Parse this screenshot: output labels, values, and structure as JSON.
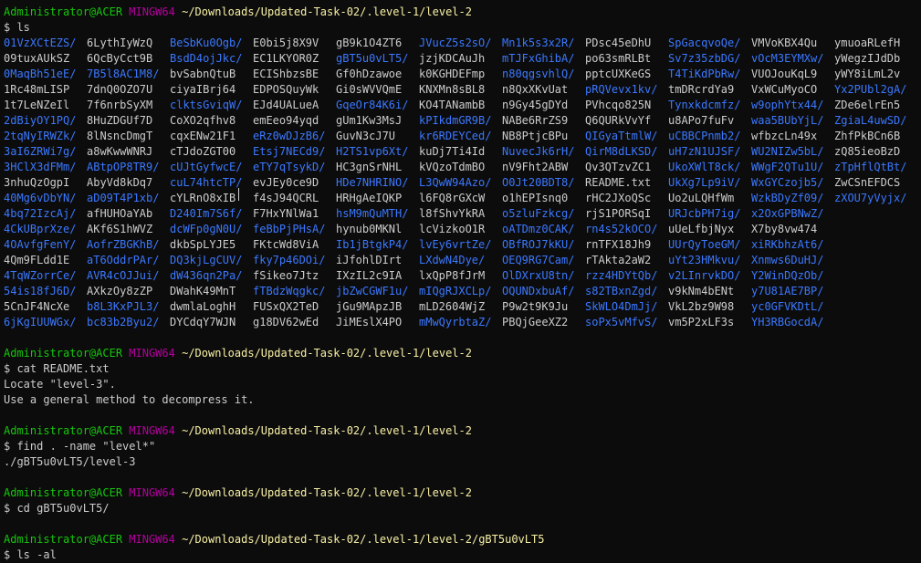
{
  "colors": {
    "background": "#0c0c0c",
    "user": "#16c60c",
    "host": "#b4009e",
    "path": "#f9f1a5",
    "directory": "#3b78ff",
    "text": "#cccccc"
  },
  "ls_listing": {
    "rows": [
      [
        {
          "t": "01VzXCtEZS/",
          "d": true
        },
        {
          "t": "6LythIyWzQ",
          "d": false
        },
        {
          "t": "BeSbKu0Ogb/",
          "d": true
        },
        {
          "t": "E0bi5j8X9V",
          "d": false
        },
        {
          "t": "gB9k1O4ZT6",
          "d": false
        },
        {
          "t": "JVucZ5s2sO/",
          "d": true
        },
        {
          "t": "Mn1k5s3x2R/",
          "d": true
        },
        {
          "t": "PDsc45eDhU",
          "d": false
        },
        {
          "t": "SpGacqvoQe/",
          "d": true
        },
        {
          "t": "VMVoKBX4Qu",
          "d": false
        },
        {
          "t": "ymuoaRLefH",
          "d": false
        }
      ],
      [
        {
          "t": "09tuxAUkSZ",
          "d": false
        },
        {
          "t": "6QcByCct9B",
          "d": false
        },
        {
          "t": "BsdD4ojJkc/",
          "d": true
        },
        {
          "t": "EC1LKYOR0Z",
          "d": false
        },
        {
          "t": "gBT5u0vLT5/",
          "d": true
        },
        {
          "t": "jzjKDCAuJh",
          "d": false
        },
        {
          "t": "mTJFxGhibA/",
          "d": true
        },
        {
          "t": "po63smRLBt",
          "d": false
        },
        {
          "t": "Sv7z35zbDG/",
          "d": true
        },
        {
          "t": "vOcM3EYMXw/",
          "d": true
        },
        {
          "t": "yWegzIJdDb",
          "d": false
        }
      ],
      [
        {
          "t": "0MaqBh51eE/",
          "d": true
        },
        {
          "t": "7B5l8AC1M8/",
          "d": true
        },
        {
          "t": "bvSabnQtuB",
          "d": false
        },
        {
          "t": "ECIShbzsBE",
          "d": false
        },
        {
          "t": "Gf0hDzawoe",
          "d": false
        },
        {
          "t": "k0KGHDEFmp",
          "d": false
        },
        {
          "t": "n80qgsvhlQ/",
          "d": true
        },
        {
          "t": "pptcUXKeGS",
          "d": false
        },
        {
          "t": "T4TiKdPbRw/",
          "d": true
        },
        {
          "t": "VUOJouKqL9",
          "d": false
        },
        {
          "t": "yWY8iLmL2v",
          "d": false
        }
      ],
      [
        {
          "t": "1Rc48mLISP",
          "d": false
        },
        {
          "t": "7dnQ0OZO7U",
          "d": false
        },
        {
          "t": "ciyaIBrj64",
          "d": false
        },
        {
          "t": "EDPOSQuyWk",
          "d": false
        },
        {
          "t": "Gi0sWVVQmE",
          "d": false
        },
        {
          "t": "KNXMn8sBL8",
          "d": false
        },
        {
          "t": "n8QxXKvUat",
          "d": false
        },
        {
          "t": "pRQVevx1kv/",
          "d": true
        },
        {
          "t": "tmDRcrdYa9",
          "d": false
        },
        {
          "t": "VxWCuMyoCO",
          "d": false
        },
        {
          "t": "Yx2PUbl2gA/",
          "d": true
        }
      ],
      [
        {
          "t": "1t7LeNZeIl",
          "d": false
        },
        {
          "t": "7f6nrbSyXM",
          "d": false
        },
        {
          "t": "clktsGviqW/",
          "d": true
        },
        {
          "t": "EJd4UALueA",
          "d": false
        },
        {
          "t": "GqeOr84K6i/",
          "d": true
        },
        {
          "t": "KO4TANambB",
          "d": false
        },
        {
          "t": "n9Gy45gDYd",
          "d": false
        },
        {
          "t": "PVhcqo825N",
          "d": false
        },
        {
          "t": "Tynxkdcmfz/",
          "d": true
        },
        {
          "t": "w9ophYtx44/",
          "d": true
        },
        {
          "t": "ZDe6elrEn5",
          "d": false
        }
      ],
      [
        {
          "t": "2dBiyOY1PQ/",
          "d": true
        },
        {
          "t": "8HuZDGUf7D",
          "d": false
        },
        {
          "t": "CoXO2qfhv8",
          "d": false
        },
        {
          "t": "emEeo94yqd",
          "d": false
        },
        {
          "t": "gUm1Kw3MsJ",
          "d": false
        },
        {
          "t": "kPIkdmGR9B/",
          "d": true
        },
        {
          "t": "NABe6RrZS9",
          "d": false
        },
        {
          "t": "Q6QURkVvYf",
          "d": false
        },
        {
          "t": "u8APo7fuFv",
          "d": false
        },
        {
          "t": "waa5BUbYjL/",
          "d": true
        },
        {
          "t": "ZgiaL4uwSD/",
          "d": true
        }
      ],
      [
        {
          "t": "2tqNyIRWZk/",
          "d": true
        },
        {
          "t": "8lNsncDmgT",
          "d": false
        },
        {
          "t": "cqxENw21F1",
          "d": false
        },
        {
          "t": "eRz0wDJzB6/",
          "d": true
        },
        {
          "t": "GuvN3cJ7U",
          "d": false
        },
        {
          "t": "kr6RDEYCed/",
          "d": true
        },
        {
          "t": "NB8PtjcBPu",
          "d": false
        },
        {
          "t": "QIGyaTtmlW/",
          "d": true
        },
        {
          "t": "uCBBCPnmb2/",
          "d": true
        },
        {
          "t": "wfbzcLn49x",
          "d": false
        },
        {
          "t": "ZhfPkBCn6B",
          "d": false
        }
      ],
      [
        {
          "t": "3aI6ZRWi7g/",
          "d": true
        },
        {
          "t": "a8wKwwWNRJ",
          "d": false
        },
        {
          "t": "cTJdoZGT00",
          "d": false
        },
        {
          "t": "Etsj7NECd9/",
          "d": true
        },
        {
          "t": "H2TS1vp6Xt/",
          "d": true
        },
        {
          "t": "kuDj7Ti4Id",
          "d": false
        },
        {
          "t": "NuvecJk6rH/",
          "d": true
        },
        {
          "t": "QirM8dLKSD/",
          "d": true
        },
        {
          "t": "uH7zN1UJSF/",
          "d": true
        },
        {
          "t": "WU2NIZw5bL/",
          "d": true
        },
        {
          "t": "zQ85ieoBzD",
          "d": false
        }
      ],
      [
        {
          "t": "3HClX3dFMm/",
          "d": true
        },
        {
          "t": "ABtpOP8TR9/",
          "d": true
        },
        {
          "t": "cUJtGyfwcE/",
          "d": true
        },
        {
          "t": "eTY7qTsykD/",
          "d": true
        },
        {
          "t": "HC3gnSrNHL",
          "d": false
        },
        {
          "t": "kVQzoTdmBO",
          "d": false
        },
        {
          "t": "nV9Fht2ABW",
          "d": false
        },
        {
          "t": "Qv3QTzvZC1",
          "d": false
        },
        {
          "t": "UkoXWlT8ck/",
          "d": true
        },
        {
          "t": "WWgF2QTu1U/",
          "d": true
        },
        {
          "t": "zTpHflQtBt/",
          "d": true
        }
      ],
      [
        {
          "t": "3nhuQzOgpI",
          "d": false
        },
        {
          "t": "AbyVd8kDq7",
          "d": false
        },
        {
          "t": "cuL74htcTP/",
          "d": true
        },
        {
          "t": "evJEy0ce9D",
          "d": false
        },
        {
          "t": "HDe7NHRINO/",
          "d": true
        },
        {
          "t": "L3QwW94Azo/",
          "d": true
        },
        {
          "t": "O0Jt20BDT8/",
          "d": true
        },
        {
          "t": "README.txt",
          "d": false
        },
        {
          "t": "UkXg7Lp9iV/",
          "d": true
        },
        {
          "t": "WxGYCzojb5/",
          "d": true
        },
        {
          "t": "ZwCSnEFDCS",
          "d": false
        }
      ],
      [
        {
          "t": "40Mg6vDbYN/",
          "d": true
        },
        {
          "t": "aD09T4P1xb/",
          "d": true
        },
        {
          "t": "cYLRnO8xIB",
          "d": false
        },
        {
          "t": "f4sJ94QCRL",
          "d": false
        },
        {
          "t": "HRHgAeIQKP",
          "d": false
        },
        {
          "t": "l6FQ8rGXcW",
          "d": false
        },
        {
          "t": "o1hEPIsnq0",
          "d": false
        },
        {
          "t": "rHC2JXoQSc",
          "d": false
        },
        {
          "t": "Uo2uLQHfWm",
          "d": false
        },
        {
          "t": "WzkBDyZf09/",
          "d": true
        },
        {
          "t": "zXOU7yVyjx/",
          "d": true
        }
      ],
      [
        {
          "t": "4bq72IzcAj/",
          "d": true
        },
        {
          "t": "afHUHOaYAb",
          "d": false
        },
        {
          "t": "D240Im7S6f/",
          "d": true
        },
        {
          "t": "F7HxYNlWa1",
          "d": false
        },
        {
          "t": "hsM9mQuMTH/",
          "d": true
        },
        {
          "t": "l8fShvYkRA",
          "d": false
        },
        {
          "t": "o5zluFzkcg/",
          "d": true
        },
        {
          "t": "rjS1PORSqI",
          "d": false
        },
        {
          "t": "URJcbPH7ig/",
          "d": true
        },
        {
          "t": "x2OxGPBNwZ/",
          "d": true
        },
        {
          "t": "",
          "d": false
        }
      ],
      [
        {
          "t": "4CkUBprXze/",
          "d": true
        },
        {
          "t": "AKf6S1hWVZ",
          "d": false
        },
        {
          "t": "dcWFp0gN0U/",
          "d": true
        },
        {
          "t": "feBbPjPHsA/",
          "d": true
        },
        {
          "t": "hynub0MKNl",
          "d": false
        },
        {
          "t": "lcVizkoO1R",
          "d": false
        },
        {
          "t": "oATDmz0CAK/",
          "d": true
        },
        {
          "t": "rn4s52kOCO/",
          "d": true
        },
        {
          "t": "uUeLfbjNyx",
          "d": false
        },
        {
          "t": "X7by8vw474",
          "d": false
        },
        {
          "t": "",
          "d": false
        }
      ],
      [
        {
          "t": "4OAvfgFenY/",
          "d": true
        },
        {
          "t": "AofrZBGKhB/",
          "d": true
        },
        {
          "t": "dkbSpLYJE5",
          "d": false
        },
        {
          "t": "FKtcWd8ViA",
          "d": false
        },
        {
          "t": "Ib1jBtgkP4/",
          "d": true
        },
        {
          "t": "lvEy6vrtZe/",
          "d": true
        },
        {
          "t": "OBfROJ7kKU/",
          "d": true
        },
        {
          "t": "rnTFX18Jh9",
          "d": false
        },
        {
          "t": "UUrQyToeGM/",
          "d": true
        },
        {
          "t": "xiRKbhzAt6/",
          "d": true
        },
        {
          "t": "",
          "d": false
        }
      ],
      [
        {
          "t": "4Qm9FLdd1E",
          "d": false
        },
        {
          "t": "aT6OddrPAr/",
          "d": true
        },
        {
          "t": "DQ3kjLgCUV/",
          "d": true
        },
        {
          "t": "fky7p46DOi/",
          "d": true
        },
        {
          "t": "iJfohlDIrt",
          "d": false
        },
        {
          "t": "LXdwN4Dye/",
          "d": true
        },
        {
          "t": "OEQ9RG7Cam/",
          "d": true
        },
        {
          "t": "rTAkta2aW2",
          "d": false
        },
        {
          "t": "uYt23HMkvu/",
          "d": true
        },
        {
          "t": "Xnmws6DuHJ/",
          "d": true
        },
        {
          "t": "",
          "d": false
        }
      ],
      [
        {
          "t": "4TqWZorrCe/",
          "d": true
        },
        {
          "t": "AVR4cOJJui/",
          "d": true
        },
        {
          "t": "dW436qn2Pa/",
          "d": true
        },
        {
          "t": "fSikeo7Jtz",
          "d": false
        },
        {
          "t": "IXzIL2c9IA",
          "d": false
        },
        {
          "t": "lxQpP8fJrM",
          "d": false
        },
        {
          "t": "OlDXrxU8tn/",
          "d": true
        },
        {
          "t": "rzz4HDYtQb/",
          "d": true
        },
        {
          "t": "v2LInrvkDO/",
          "d": true
        },
        {
          "t": "Y2WinDQzOb/",
          "d": true
        },
        {
          "t": "",
          "d": false
        }
      ],
      [
        {
          "t": "54is18fJ6D/",
          "d": true
        },
        {
          "t": "AXkzOy8zZP",
          "d": false
        },
        {
          "t": "DWahK49MnT",
          "d": false
        },
        {
          "t": "fTBdzWqgkc/",
          "d": true
        },
        {
          "t": "jbZwCGWF1u/",
          "d": true
        },
        {
          "t": "mIQgRJXCLp/",
          "d": true
        },
        {
          "t": "OQUNDxbuAf/",
          "d": true
        },
        {
          "t": "s82TBxnZgd/",
          "d": true
        },
        {
          "t": "v9kNm4bENt",
          "d": false
        },
        {
          "t": "y7U81AE7BP/",
          "d": true
        },
        {
          "t": "",
          "d": false
        }
      ],
      [
        {
          "t": "5CnJF4NcXe",
          "d": false
        },
        {
          "t": "b8L3KxPJL3/",
          "d": true
        },
        {
          "t": "dwmlaLoghH",
          "d": false
        },
        {
          "t": "FUSxQX2TeD",
          "d": false
        },
        {
          "t": "jGu9MApzJB",
          "d": false
        },
        {
          "t": "mLD2604WjZ",
          "d": false
        },
        {
          "t": "P9w2t9K9Ju",
          "d": false
        },
        {
          "t": "SkWLO4DmJj/",
          "d": true
        },
        {
          "t": "VkL2bz9W98",
          "d": false
        },
        {
          "t": "yc0GFVKDtL/",
          "d": true
        },
        {
          "t": "",
          "d": false
        }
      ],
      [
        {
          "t": "6jKgIUUWGx/",
          "d": true
        },
        {
          "t": "bc83b2Byu2/",
          "d": true
        },
        {
          "t": "DYCdqY7WJN",
          "d": false
        },
        {
          "t": "g18DV62wEd",
          "d": false
        },
        {
          "t": "JiMEslX4PO",
          "d": false
        },
        {
          "t": "mMwQyrbtaZ/",
          "d": true
        },
        {
          "t": "PBQjGeeXZ2",
          "d": false
        },
        {
          "t": "soPx5vMfvS/",
          "d": true
        },
        {
          "t": "vm5P2xLF3s",
          "d": false
        },
        {
          "t": "YH3RBGocdA/",
          "d": true
        },
        {
          "t": "",
          "d": false
        }
      ]
    ]
  },
  "blocks": [
    {
      "prompt": {
        "user": "Administrator@ACER",
        "host": "MINGW64",
        "path": "~/Downloads/Updated-Task-02/.level-1/level-2"
      },
      "command": "$ ls",
      "output": [],
      "listing": true
    },
    {
      "prompt": {
        "user": "Administrator@ACER",
        "host": "MINGW64",
        "path": "~/Downloads/Updated-Task-02/.level-1/level-2"
      },
      "command": "$ cat README.txt",
      "output": [
        "Locate \"level-3\".",
        "Use a general method to decompress it."
      ]
    },
    {
      "prompt": {
        "user": "Administrator@ACER",
        "host": "MINGW64",
        "path": "~/Downloads/Updated-Task-02/.level-1/level-2"
      },
      "command": "$ find . -name \"level*\"",
      "output": [
        "./gBT5u0vLT5/level-3"
      ]
    },
    {
      "prompt": {
        "user": "Administrator@ACER",
        "host": "MINGW64",
        "path": "~/Downloads/Updated-Task-02/.level-1/level-2"
      },
      "command": "$ cd gBT5u0vLT5/",
      "output": []
    },
    {
      "prompt": {
        "user": "Administrator@ACER",
        "host": "MINGW64",
        "path": "~/Downloads/Updated-Task-02/.level-1/level-2/gBT5u0vLT5"
      },
      "command": "$ ls -al",
      "output": []
    }
  ]
}
